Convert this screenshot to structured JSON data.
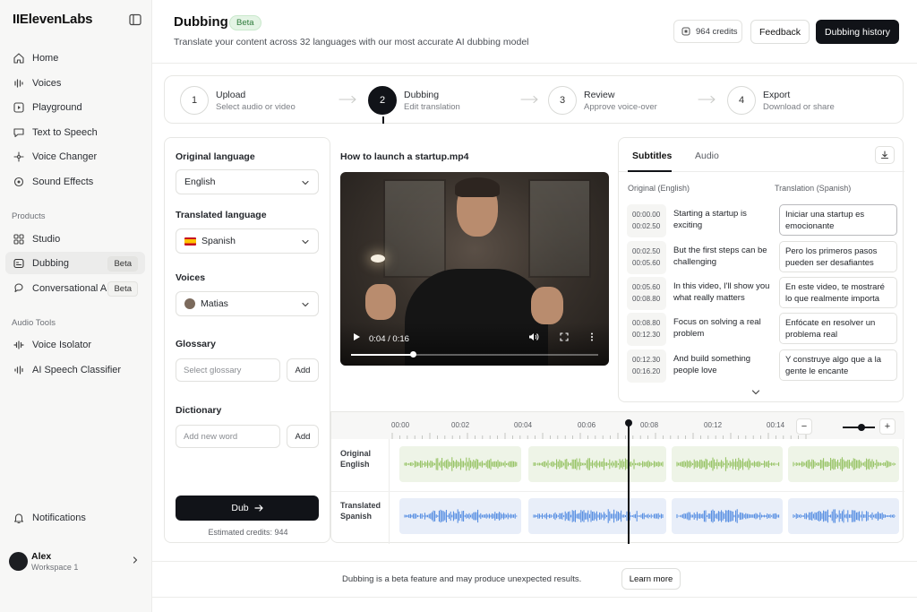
{
  "brand": {
    "logo_text": "IIElevenLabs"
  },
  "sidebar": {
    "items": [
      {
        "label": "Home",
        "icon": "home-icon"
      },
      {
        "label": "Voices",
        "icon": "voices-icon"
      },
      {
        "label": "Playground",
        "icon": "playground-icon"
      },
      {
        "label": "Text to Speech",
        "icon": "text-to-speech-icon"
      },
      {
        "label": "Voice Changer",
        "icon": "voice-changer-icon"
      },
      {
        "label": "Sound Effects",
        "icon": "sound-effects-icon"
      }
    ],
    "products_heading": "Products",
    "products": [
      {
        "label": "Studio",
        "icon": "studio-icon"
      },
      {
        "label": "Dubbing",
        "icon": "dubbing-icon",
        "badge": "Beta",
        "active": true
      },
      {
        "label": "Conversational AI",
        "icon": "conversational-ai-icon",
        "badge": "Beta"
      }
    ],
    "audio_tools_heading": "Audio Tools",
    "audio_tools": [
      {
        "label": "Voice Isolator",
        "icon": "voice-isolator-icon"
      },
      {
        "label": "AI Speech Classifier",
        "icon": "speech-classifier-icon"
      }
    ],
    "notifications_label": "Notifications",
    "user": {
      "name": "Alex",
      "workspace": "Workspace 1"
    }
  },
  "header": {
    "title": "Dubbing",
    "badge": "Beta",
    "subtitle": "Translate your content across 32 languages with our most accurate AI dubbing model",
    "credits": "964 credits",
    "feedback_label": "Feedback",
    "history_label": "Dubbing history"
  },
  "stepper": {
    "steps": [
      {
        "number": "1",
        "title": "Upload",
        "subtitle": "Select audio or video"
      },
      {
        "number": "2",
        "title": "Dubbing",
        "subtitle": "Edit translation",
        "active": true
      },
      {
        "number": "3",
        "title": "Review",
        "subtitle": "Approve voice-over"
      },
      {
        "number": "4",
        "title": "Export",
        "subtitle": "Download or share"
      }
    ]
  },
  "settings": {
    "original_language_label": "Original language",
    "original_language_value": "English",
    "translated_language_label": "Translated language",
    "translated_language_value": "Spanish",
    "voices_label": "Voices",
    "voice_value": "Matias",
    "glossary_label": "Glossary",
    "glossary_placeholder": "Select glossary",
    "glossary_add": "Add",
    "dictionary_label": "Dictionary",
    "dictionary_placeholder": "Add new word",
    "dictionary_add": "Add",
    "dub_label": "Dub",
    "estimated_credits": "Estimated credits: 944"
  },
  "video": {
    "filename": "How to launch a startup.mp4",
    "time": "0:04 / 0:16",
    "progress": 0.25
  },
  "subtitles_panel": {
    "tabs": [
      "Subtitles",
      "Audio"
    ],
    "active_tab": "Subtitles",
    "original_header": "Original (English)",
    "translation_header": "Translation (Spanish)",
    "rows": [
      {
        "start": "00:00.00",
        "end": "00:02.50",
        "original": "Starting a startup is exciting",
        "translation": "Iniciar una startup es emocionante"
      },
      {
        "start": "00:02.50",
        "end": "00:05.60",
        "original": "But the first steps can be challenging",
        "translation": "Pero los primeros pasos pueden ser desafiantes"
      },
      {
        "start": "00:05.60",
        "end": "00:08.80",
        "original": "In this video, I'll show you what really matters",
        "translation": "En este video, te mostraré lo que realmente importa"
      },
      {
        "start": "00:08.80",
        "end": "00:12.30",
        "original": "Focus on solving a real problem",
        "translation": "Enfócate en resolver un problema real"
      },
      {
        "start": "00:12.30",
        "end": "00:16.20",
        "original": "And build something people love",
        "translation": "Y construye algo que a la gente le encante"
      }
    ]
  },
  "timeline": {
    "ticks": [
      "00:00",
      "00:02",
      "00:04",
      "00:06",
      "00:08",
      "00:12",
      "00:14"
    ],
    "original_track_label": "Original English",
    "translated_track_label": "Translated Spanish",
    "colors": {
      "original": "#8fbf5a",
      "translated": "#4a86e0"
    }
  },
  "footer": {
    "notice": "Dubbing is a beta feature and may produce unexpected results.",
    "learn_more": "Learn more"
  }
}
